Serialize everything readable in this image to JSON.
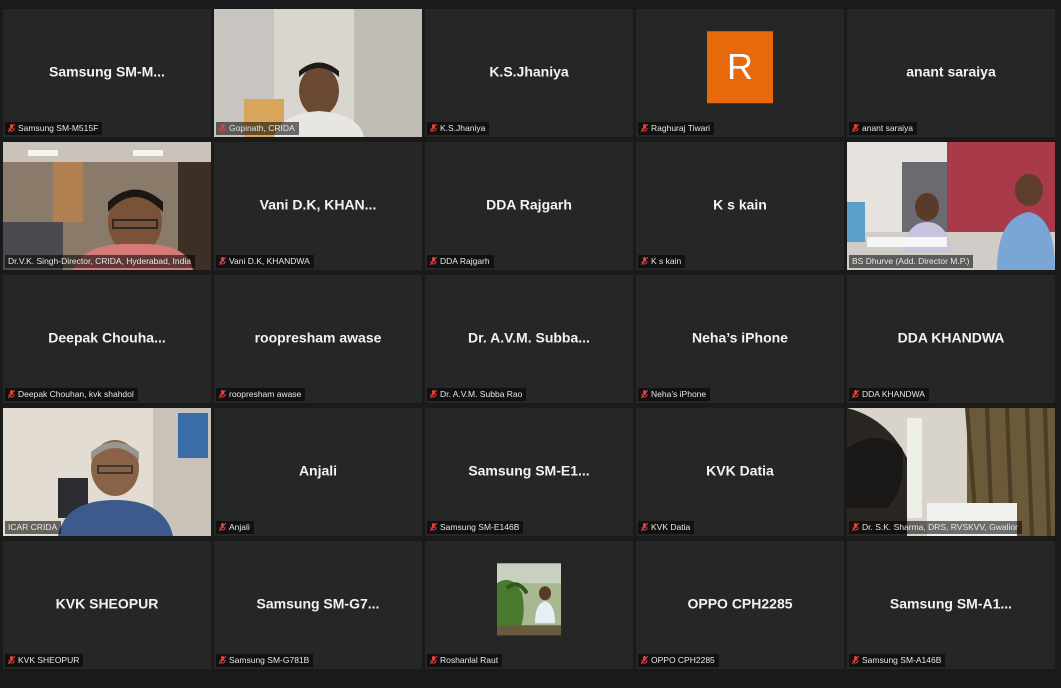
{
  "colors": {
    "active_border": "#b5d84a",
    "avatar_bg": "#e8690b",
    "muted_icon": "#e0403a"
  },
  "tiles": [
    {
      "name": "Samsung  SM-M...",
      "caption": "Samsung SM-M515F"
    },
    {
      "name": "",
      "caption": "Gopinath, CRIDA"
    },
    {
      "name": "K.S.Jhaniya",
      "caption": "K.S.Jhaniya"
    },
    {
      "name": "",
      "avatar_letter": "R",
      "caption": "Raghuraj Tiwari"
    },
    {
      "name": "anant saraiya",
      "caption": "anant saraiya"
    },
    {
      "name": "",
      "caption": "Dr.V.K. Singh-Director, CRIDA, Hyderabad, India"
    },
    {
      "name": "Vani D.K,  KHAN...",
      "caption": "Vani D.K, KHANDWA"
    },
    {
      "name": "DDA Rajgarh",
      "caption": "DDA Rajgarh"
    },
    {
      "name": "K s kain",
      "caption": "K s kain"
    },
    {
      "name": "",
      "caption": "BS Dhurve (Add. Director M.P.)"
    },
    {
      "name": "Deepak  Chouha...",
      "caption": "Deepak Chouhan, kvk shahdol"
    },
    {
      "name": "roopresham awase",
      "caption": "roopresham awase"
    },
    {
      "name": "Dr.  A.V.M.  Subba...",
      "caption": "Dr. A.V.M. Subba Rao"
    },
    {
      "name": "Neha’s iPhone",
      "caption": "Neha’s iPhone"
    },
    {
      "name": "DDA KHANDWA",
      "caption": "DDA KHANDWA"
    },
    {
      "name": "",
      "caption": "ICAR CRIDA"
    },
    {
      "name": "Anjali",
      "caption": "Anjali"
    },
    {
      "name": "Samsung  SM-E1...",
      "caption": "Samsung SM-E146B"
    },
    {
      "name": "KVK Datia",
      "caption": "KVK Datia"
    },
    {
      "name": "",
      "caption": "Dr. S.K. Sharma, DRS, RVSKVV, Gwalior"
    },
    {
      "name": "KVK SHEOPUR",
      "caption": "KVK SHEOPUR"
    },
    {
      "name": "Samsung  SM-G7...",
      "caption": "Samsung SM-G781B"
    },
    {
      "name": "",
      "caption": "Roshanlal Raut"
    },
    {
      "name": "OPPO CPH2285",
      "caption": "OPPO CPH2285"
    },
    {
      "name": "Samsung  SM-A1...",
      "caption": "Samsung SM-A146B"
    }
  ]
}
